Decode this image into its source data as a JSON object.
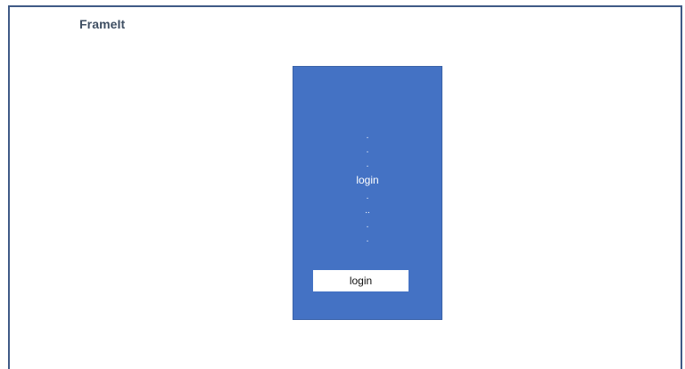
{
  "app": {
    "title": "FrameIt"
  },
  "login_panel": {
    "dots_top": [
      ".",
      ".",
      "."
    ],
    "label": "login",
    "dots_bottom": [
      ".",
      "..",
      ".",
      "."
    ],
    "button_label": "login"
  },
  "colors": {
    "panel_fill": "#4472c4",
    "frame_border": "#3f5a86",
    "title_text": "#3f4f63",
    "button_fill": "#ffffff"
  }
}
